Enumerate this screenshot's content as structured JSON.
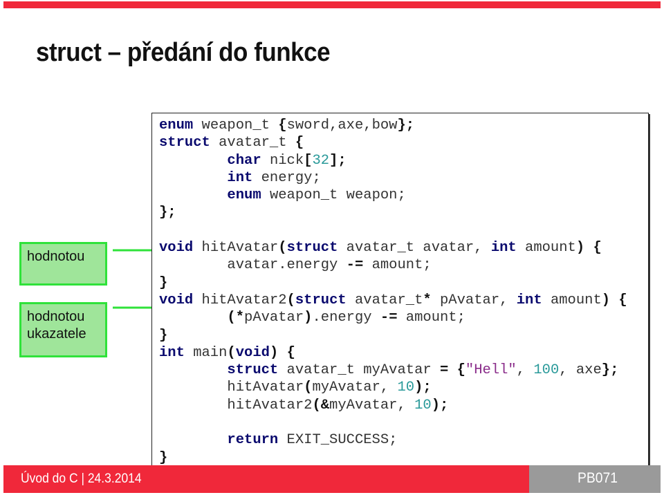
{
  "slide": {
    "title": "struct – předání do funkce"
  },
  "labels": {
    "by_value": "hodnotou",
    "by_pointer_line1": "hodnotou",
    "by_pointer_line2": "ukazatele"
  },
  "code": {
    "lines": [
      [
        {
          "t": "enum",
          "c": "kw"
        },
        {
          "t": " weapon_t "
        },
        {
          "t": "{",
          "c": "op"
        },
        {
          "t": "sword,axe,bow"
        },
        {
          "t": "};",
          "c": "op"
        }
      ],
      [
        {
          "t": "struct",
          "c": "kw"
        },
        {
          "t": " avatar_t "
        },
        {
          "t": "{",
          "c": "op"
        }
      ],
      [
        {
          "t": "        "
        },
        {
          "t": "char",
          "c": "kw"
        },
        {
          "t": " nick"
        },
        {
          "t": "[",
          "c": "op"
        },
        {
          "t": "32",
          "c": "num"
        },
        {
          "t": "];",
          "c": "op"
        }
      ],
      [
        {
          "t": "        "
        },
        {
          "t": "int",
          "c": "kw"
        },
        {
          "t": " energy;"
        }
      ],
      [
        {
          "t": "        "
        },
        {
          "t": "enum",
          "c": "kw"
        },
        {
          "t": " weapon_t weapon;"
        }
      ],
      [
        {
          "t": "};",
          "c": "op"
        }
      ],
      [
        {
          "t": ""
        }
      ],
      [
        {
          "t": "void",
          "c": "kw"
        },
        {
          "t": " hitAvatar"
        },
        {
          "t": "(",
          "c": "op"
        },
        {
          "t": "struct",
          "c": "kw"
        },
        {
          "t": " avatar_t avatar, "
        },
        {
          "t": "int",
          "c": "kw"
        },
        {
          "t": " amount"
        },
        {
          "t": ")",
          "c": "op"
        },
        {
          "t": " "
        },
        {
          "t": "{",
          "c": "op"
        }
      ],
      [
        {
          "t": "        avatar.energy "
        },
        {
          "t": "-=",
          "c": "op"
        },
        {
          "t": " amount;"
        }
      ],
      [
        {
          "t": "}",
          "c": "op"
        }
      ],
      [
        {
          "t": "void",
          "c": "kw"
        },
        {
          "t": " hitAvatar2"
        },
        {
          "t": "(",
          "c": "op"
        },
        {
          "t": "struct",
          "c": "kw"
        },
        {
          "t": " avatar_t"
        },
        {
          "t": "*",
          "c": "op"
        },
        {
          "t": " pAvatar, "
        },
        {
          "t": "int",
          "c": "kw"
        },
        {
          "t": " amount"
        },
        {
          "t": ")",
          "c": "op"
        },
        {
          "t": " "
        },
        {
          "t": "{",
          "c": "op"
        }
      ],
      [
        {
          "t": "        "
        },
        {
          "t": "(*",
          "c": "op"
        },
        {
          "t": "pAvatar"
        },
        {
          "t": ")",
          "c": "op"
        },
        {
          "t": ".energy "
        },
        {
          "t": "-=",
          "c": "op"
        },
        {
          "t": " amount;"
        }
      ],
      [
        {
          "t": "}",
          "c": "op"
        }
      ],
      [
        {
          "t": "int",
          "c": "kw"
        },
        {
          "t": " main"
        },
        {
          "t": "(",
          "c": "op"
        },
        {
          "t": "void",
          "c": "kw"
        },
        {
          "t": ")",
          "c": "op"
        },
        {
          "t": " "
        },
        {
          "t": "{",
          "c": "op"
        }
      ],
      [
        {
          "t": "        "
        },
        {
          "t": "struct",
          "c": "kw"
        },
        {
          "t": " avatar_t myAvatar "
        },
        {
          "t": "=",
          "c": "op"
        },
        {
          "t": " "
        },
        {
          "t": "{",
          "c": "op"
        },
        {
          "t": "\"Hell\"",
          "c": "str"
        },
        {
          "t": ", "
        },
        {
          "t": "100",
          "c": "num"
        },
        {
          "t": ", axe"
        },
        {
          "t": "};",
          "c": "op"
        }
      ],
      [
        {
          "t": "        hitAvatar"
        },
        {
          "t": "(",
          "c": "op"
        },
        {
          "t": "myAvatar, "
        },
        {
          "t": "10",
          "c": "num"
        },
        {
          "t": ");",
          "c": "op"
        }
      ],
      [
        {
          "t": "        hitAvatar2"
        },
        {
          "t": "(&",
          "c": "op"
        },
        {
          "t": "myAvatar, "
        },
        {
          "t": "10",
          "c": "num"
        },
        {
          "t": ");",
          "c": "op"
        }
      ],
      [
        {
          "t": ""
        }
      ],
      [
        {
          "t": "        "
        },
        {
          "t": "return",
          "c": "kw"
        },
        {
          "t": " EXIT_SUCCESS;"
        }
      ],
      [
        {
          "t": "}",
          "c": "op"
        }
      ]
    ]
  },
  "footer": {
    "left_text": "Úvod do C | 24.3.2014",
    "right_text": "PB071"
  },
  "colors": {
    "accent_red": "#f0283a",
    "footer_gray": "#9a9a9a",
    "label_fill": "#9fe59a",
    "label_border": "#2fe23a",
    "keyword": "#0a0a6e"
  }
}
